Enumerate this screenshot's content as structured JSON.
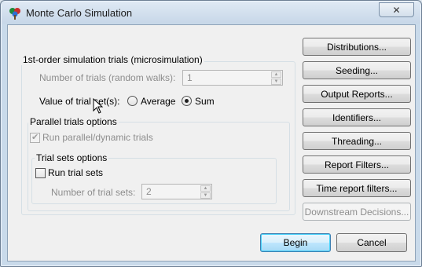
{
  "window": {
    "title": "Monte Carlo Simulation",
    "close_glyph": "✕",
    "icon": "app-tree-icon"
  },
  "first_order": {
    "legend": "1st-order simulation trials (microsimulation)",
    "num_trials_label": "Number of trials (random walks):",
    "num_trials_value": "1",
    "value_of_trial_label": "Value of trial set(s):",
    "radio_average": "Average",
    "radio_sum": "Sum",
    "selected": "Sum"
  },
  "parallel": {
    "legend": "Parallel trials options",
    "run_parallel_label": "Run parallel/dynamic trials",
    "run_parallel_checked": true
  },
  "trial_sets": {
    "legend": "Trial sets options",
    "run_trial_sets_label": "Run trial sets",
    "run_trial_sets_checked": false,
    "num_sets_label": "Number of trial sets:",
    "num_sets_value": "2"
  },
  "side_buttons": [
    "Distributions...",
    "Seeding...",
    "Output Reports...",
    "Identifiers...",
    "Threading...",
    "Report Filters...",
    "Time report filters...",
    "Downstream Decisions..."
  ],
  "footer": {
    "begin": "Begin",
    "cancel": "Cancel"
  },
  "colors": {
    "primary_border": "#3c7fb1",
    "disabled_text": "#8d8d8d"
  }
}
